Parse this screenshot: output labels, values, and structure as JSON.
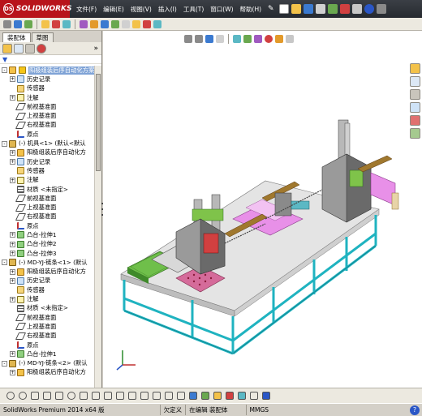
{
  "app": {
    "brand": "SOLIDWORKS",
    "logo_mark": "DS"
  },
  "menu": [
    "文件(F)",
    "编辑(E)",
    "视图(V)",
    "插入(I)",
    "工具(T)",
    "窗口(W)",
    "帮助(H)"
  ],
  "panel": {
    "tabs": [
      "装配体",
      "草图"
    ],
    "active_tab": 0
  },
  "tree": [
    {
      "indent": 0,
      "expander": "-",
      "icon": "asm",
      "text": "阳极组装后序自动化方案",
      "selected": true
    },
    {
      "indent": 1,
      "expander": "+",
      "icon": "hist",
      "text": "历史记录"
    },
    {
      "indent": 1,
      "expander": "",
      "icon": "sensor",
      "text": "传感器"
    },
    {
      "indent": 1,
      "expander": "+",
      "icon": "note",
      "text": "注解"
    },
    {
      "indent": 1,
      "expander": "",
      "icon": "plane",
      "text": "前视基准面"
    },
    {
      "indent": 1,
      "expander": "",
      "icon": "plane",
      "text": "上视基准面"
    },
    {
      "indent": 1,
      "expander": "",
      "icon": "plane",
      "text": "右视基准面"
    },
    {
      "indent": 1,
      "expander": "",
      "icon": "origin",
      "text": "原点"
    },
    {
      "indent": 0,
      "expander": "-",
      "icon": "part",
      "text": "(-) 机具<1> (默认<默认"
    },
    {
      "indent": 1,
      "expander": "+",
      "icon": "asm",
      "text": "阳极组装后序自动化方"
    },
    {
      "indent": 1,
      "expander": "+",
      "icon": "hist",
      "text": "历史记录"
    },
    {
      "indent": 1,
      "expander": "",
      "icon": "sensor",
      "text": "传感器"
    },
    {
      "indent": 1,
      "expander": "+",
      "icon": "note",
      "text": "注解"
    },
    {
      "indent": 1,
      "expander": "",
      "icon": "mat",
      "text": "材质 <未指定>"
    },
    {
      "indent": 1,
      "expander": "",
      "icon": "plane",
      "text": "前视基准面"
    },
    {
      "indent": 1,
      "expander": "",
      "icon": "plane",
      "text": "上视基准面"
    },
    {
      "indent": 1,
      "expander": "",
      "icon": "plane",
      "text": "右视基准面"
    },
    {
      "indent": 1,
      "expander": "",
      "icon": "origin",
      "text": "原点"
    },
    {
      "indent": 1,
      "expander": "+",
      "icon": "feat",
      "text": "凸台-拉伸1"
    },
    {
      "indent": 1,
      "expander": "+",
      "icon": "feat",
      "text": "凸台-拉伸2"
    },
    {
      "indent": 1,
      "expander": "+",
      "icon": "feat",
      "text": "凸台-拉伸3"
    },
    {
      "indent": 0,
      "expander": "-",
      "icon": "part",
      "text": "(-) MD-YJ-链条<1> (默认"
    },
    {
      "indent": 1,
      "expander": "+",
      "icon": "asm",
      "text": "阳极组装后序自动化方"
    },
    {
      "indent": 1,
      "expander": "+",
      "icon": "hist",
      "text": "历史记录"
    },
    {
      "indent": 1,
      "expander": "",
      "icon": "sensor",
      "text": "传感器"
    },
    {
      "indent": 1,
      "expander": "+",
      "icon": "note",
      "text": "注解"
    },
    {
      "indent": 1,
      "expander": "",
      "icon": "mat",
      "text": "材质 <未指定>"
    },
    {
      "indent": 1,
      "expander": "",
      "icon": "plane",
      "text": "前视基准面"
    },
    {
      "indent": 1,
      "expander": "",
      "icon": "plane",
      "text": "上视基准面"
    },
    {
      "indent": 1,
      "expander": "",
      "icon": "plane",
      "text": "右视基准面"
    },
    {
      "indent": 1,
      "expander": "",
      "icon": "origin",
      "text": "原点"
    },
    {
      "indent": 1,
      "expander": "+",
      "icon": "feat",
      "text": "凸台-拉伸1"
    },
    {
      "indent": 0,
      "expander": "-",
      "icon": "part",
      "text": "(-) MD-YJ-链条<2> (默认"
    },
    {
      "indent": 1,
      "expander": "+",
      "icon": "asm",
      "text": "阳极组装后序自动化方"
    }
  ],
  "status": {
    "version": "SolidWorks Premium 2014 x64 版",
    "state": "欠定义",
    "mode": "在编辑 装配体",
    "units": "MMGS"
  },
  "colors": {
    "frame": "#1fb3c0",
    "tabletop": "#e4e4e4",
    "pink": "#e890e8",
    "green": "#7fc34a",
    "brown": "#8a6a2a"
  }
}
